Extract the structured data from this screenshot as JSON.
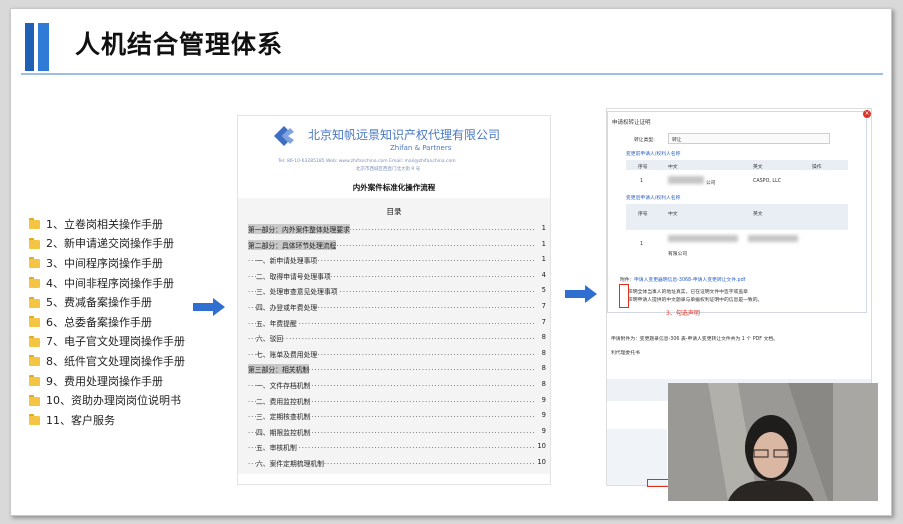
{
  "slide": {
    "title": "人机结合管理体系"
  },
  "menu": {
    "items": [
      "1、立卷岗相关操作手册",
      "2、新申请递交岗操作手册",
      "3、中间程序岗操作手册",
      "4、中间非程序岗操作手册",
      "5、费减备案操作手册",
      "6、总委备案操作手册",
      "7、电子官文处理岗操作手册",
      "8、纸件官文处理岗操作手册",
      "9、费用处理岗操作手册",
      "10、资助办理岗岗位说明书",
      "11、客户服务"
    ]
  },
  "document": {
    "firm_name": "北京知帆远景知识产权代理有限公司",
    "firm_name_en": "Zhifan & Partners",
    "contact_line1": "Tel: 86-10-63285185   Web: www.zhifanchina.com   Email: mail@zhifanchina.com",
    "contact_line2": "北京市西城区西直门北大街 9 号",
    "title": "内外案件标准化操作流程",
    "toc_heading": "目录",
    "toc": [
      {
        "text": "第一部分：内外案件整体处理要求",
        "page": "1",
        "highlight": true,
        "indent": false
      },
      {
        "text": "第二部分：具体环节处理流程",
        "page": "1",
        "highlight": true,
        "indent": false
      },
      {
        "text": "一、新申请处理事项",
        "page": "1",
        "highlight": false,
        "indent": true
      },
      {
        "text": "二、取得申请号处理事项",
        "page": "4",
        "highlight": false,
        "indent": true
      },
      {
        "text": "三、处理审查意见处理事项",
        "page": "5",
        "highlight": false,
        "indent": true
      },
      {
        "text": "四、办登或年费处理",
        "page": "7",
        "highlight": false,
        "indent": true
      },
      {
        "text": "五、年费提醒",
        "page": "7",
        "highlight": false,
        "indent": true
      },
      {
        "text": "六、驳回",
        "page": "8",
        "highlight": false,
        "indent": true
      },
      {
        "text": "七、账单及费用处理",
        "page": "8",
        "highlight": false,
        "indent": true
      },
      {
        "text": "第三部分：相关机制",
        "page": "8",
        "highlight": true,
        "indent": false
      },
      {
        "text": "一、文件存档机制",
        "page": "8",
        "highlight": false,
        "indent": true
      },
      {
        "text": "二、费用监控机制",
        "page": "9",
        "highlight": false,
        "indent": true
      },
      {
        "text": "三、定期核查机制",
        "page": "9",
        "highlight": false,
        "indent": true
      },
      {
        "text": "四、期限监控机制",
        "page": "9",
        "highlight": false,
        "indent": true
      },
      {
        "text": "五、审核机制",
        "page": "10",
        "highlight": false,
        "indent": true
      },
      {
        "text": "六、案件定期梳理机制",
        "page": "10",
        "highlight": false,
        "indent": true
      }
    ]
  },
  "screenshot": {
    "dialog_title": "申请权转让证明",
    "type_label": "转让类型:",
    "type_value": "转让",
    "section_before": "变更前申请人/权利人名称",
    "section_after": "变更后申请人/权利人名称",
    "col_no": "序号",
    "col_cn": "中文",
    "col_en": "英文",
    "col_op": "操作",
    "row1_no": "1",
    "row1_cn": "公司",
    "row1_en": "CASPO, LLC",
    "row2_no": "1",
    "row2_cn": "有限公司",
    "attach_label": "附件：",
    "attach_link": "申请人变更器明信息-3068-申请人变更转让文件.pdf",
    "check1": "声明全体当事人的地址真实，已在证明文件中签字或盖章",
    "check2": "声明申请人提供的中文题录与单据权利证明中的信息是一致的。",
    "annotation": "3、勾选声明",
    "note": "申请附件为：变更题录信息-306 表-申请人变更转让文件共为 1 个 PDF 文档。",
    "note2": "利代理委托书"
  },
  "colors": {
    "accent": "#1f5fb4",
    "accent_light": "#2f7bd6",
    "arrow": "#2f6fd0",
    "annotation": "#e0301e"
  },
  "icons": [
    "folder-icon",
    "arrow-right-icon",
    "firm-logo-icon",
    "close-icon"
  ]
}
